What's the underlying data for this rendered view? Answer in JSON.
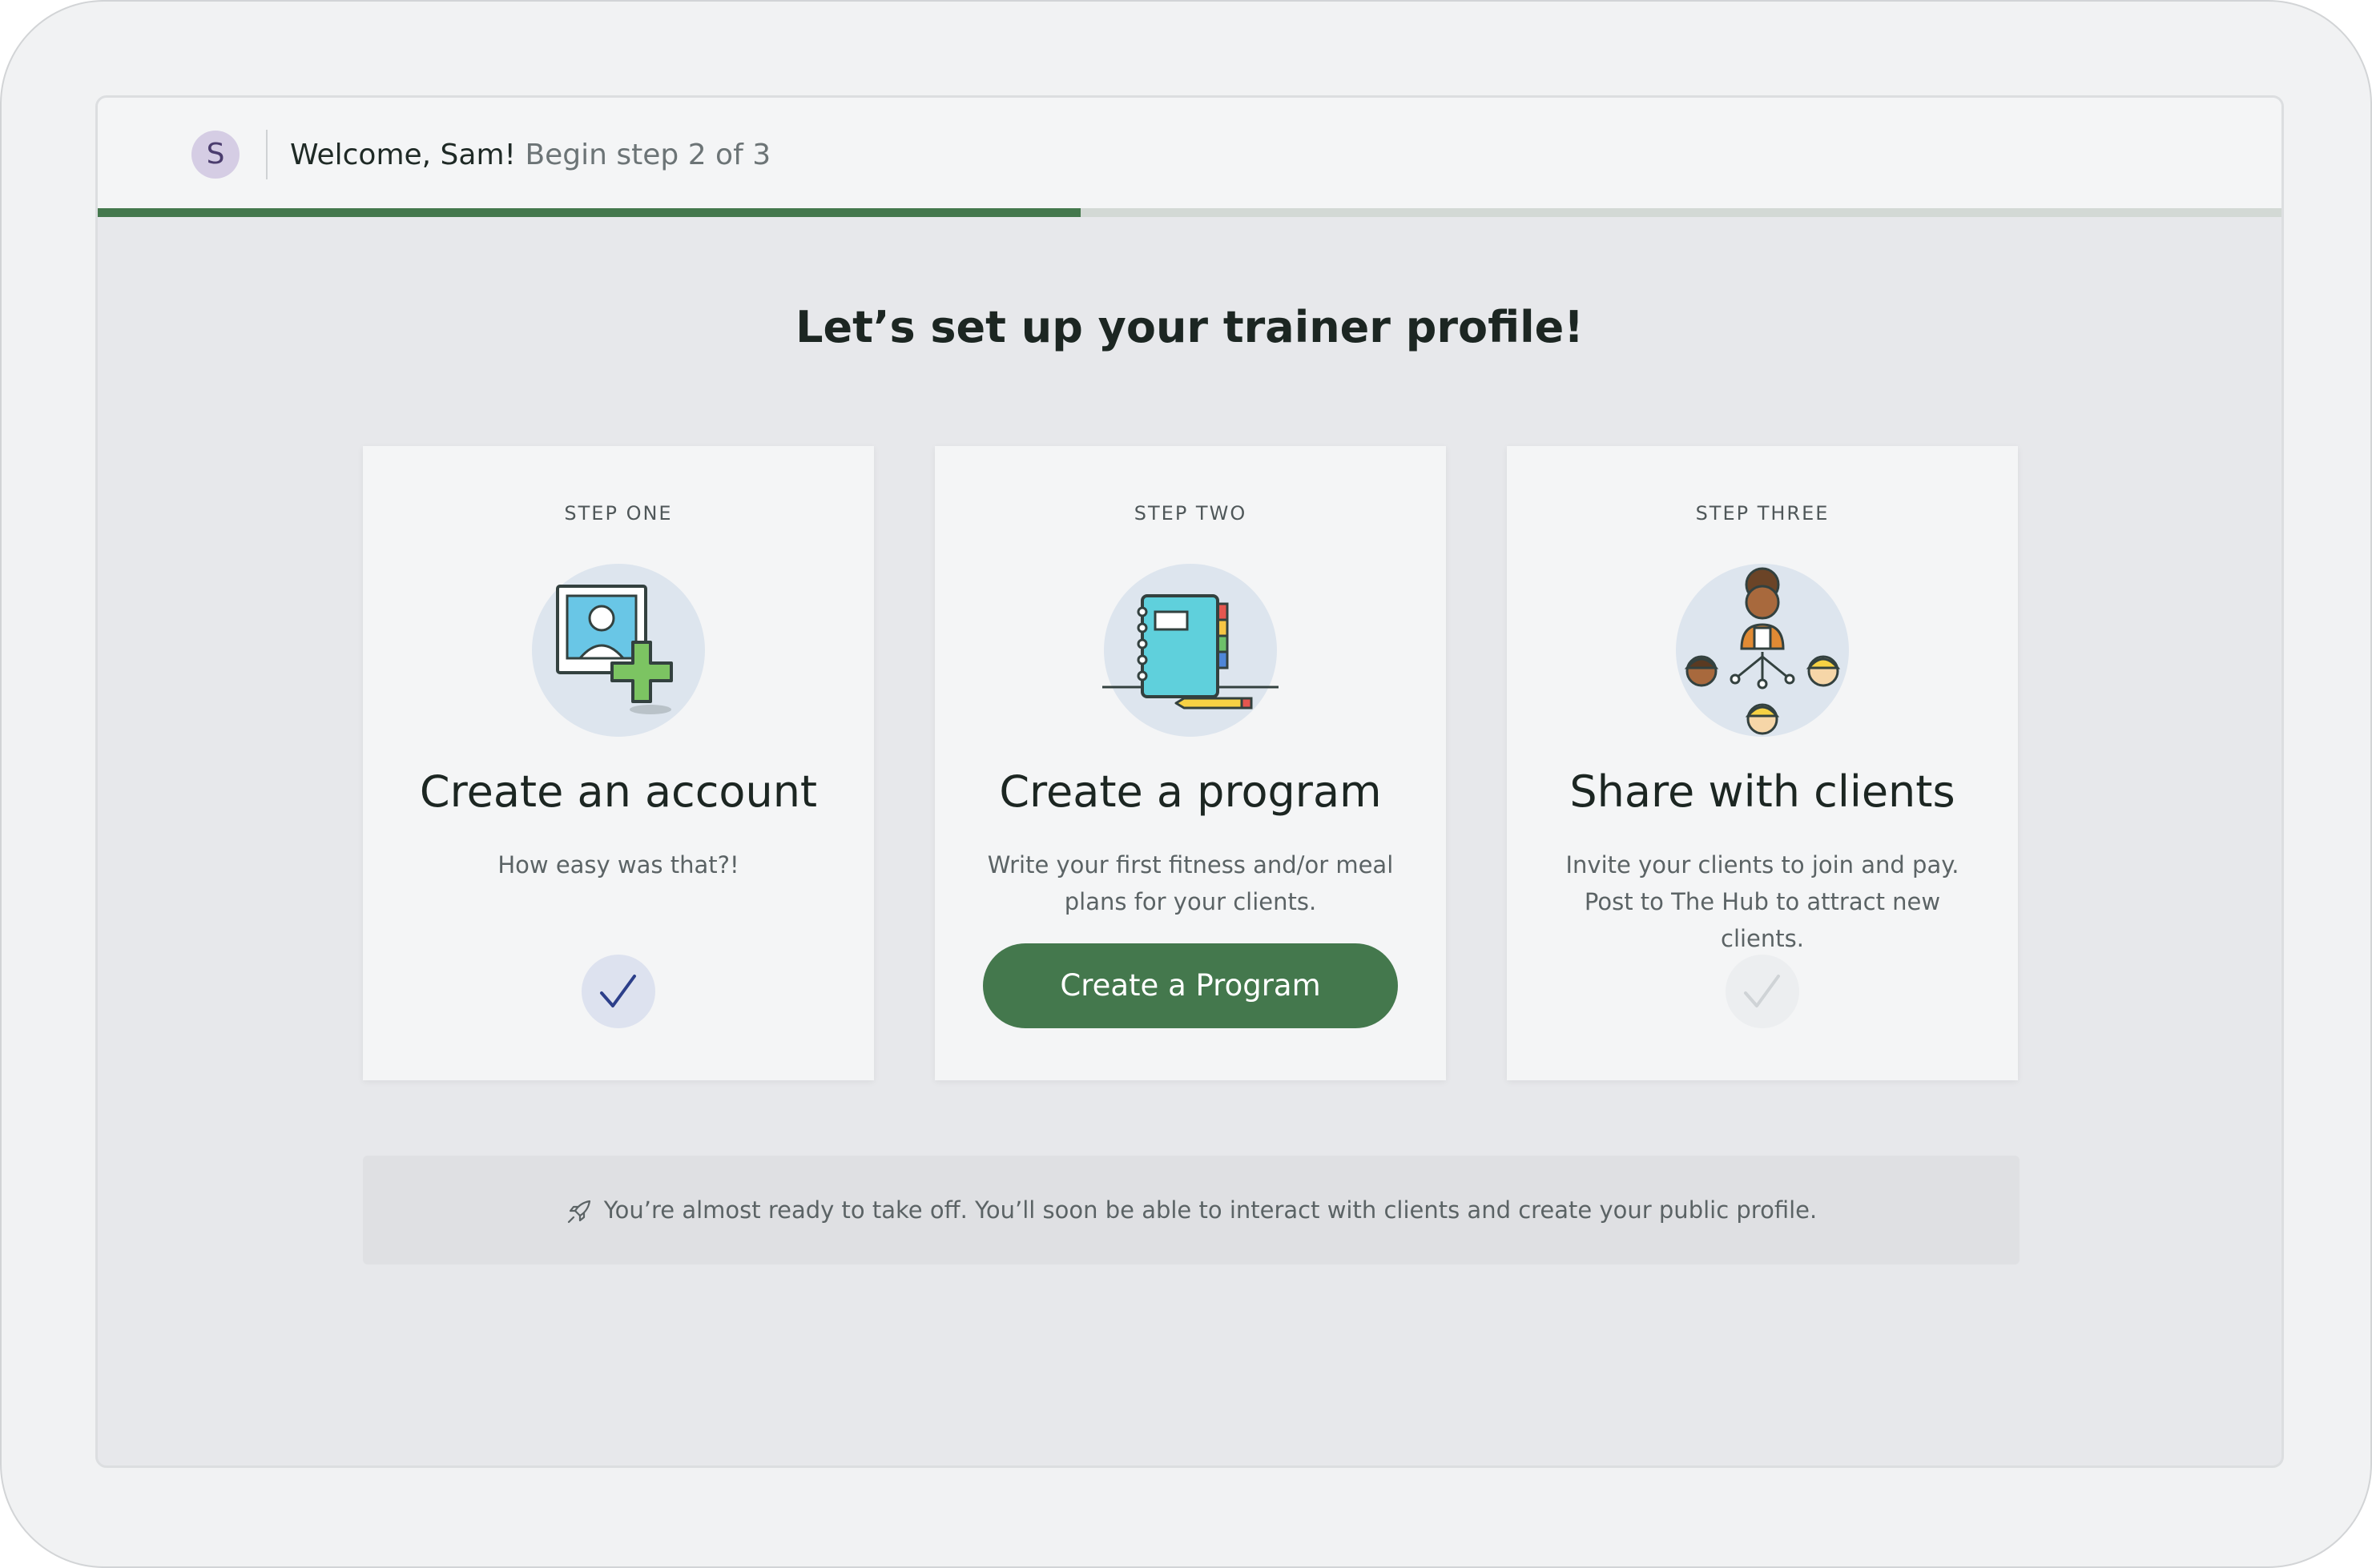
{
  "header": {
    "avatar_initial": "S",
    "greeting": "Welcome, Sam!",
    "step_text": "Begin step 2 of 3",
    "progress_fraction": 0.45
  },
  "main": {
    "heading": "Let’s set up your trainer profile!",
    "cards": [
      {
        "eyebrow": "STEP ONE",
        "title": "Create an account",
        "description": "How easy was that?!",
        "status": "complete",
        "icon": "profile-photo-add-icon"
      },
      {
        "eyebrow": "STEP TWO",
        "title": "Create a program",
        "description": "Write your first fitness and/or meal plans for your clients.",
        "button_label": "Create a Program",
        "icon": "notebook-pencil-icon"
      },
      {
        "eyebrow": "STEP THREE",
        "title": "Share with clients",
        "description": "Invite your clients to join and pay. Post to The Hub to attract new clients.",
        "status": "pending",
        "icon": "trainer-clients-network-icon"
      }
    ],
    "notice": {
      "icon": "rocket-icon",
      "text": "You’re almost ready to take off. You’ll soon be able to interact with clients and create your public profile."
    }
  },
  "colors": {
    "accent_green": "#44784d",
    "avatar_bg": "#d5cde4",
    "check_done": "#2c3f8a"
  }
}
